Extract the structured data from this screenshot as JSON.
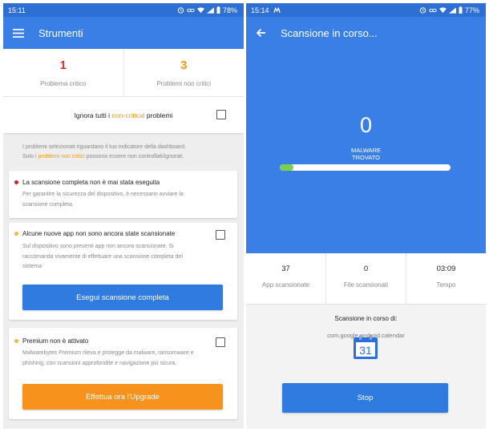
{
  "left": {
    "status": {
      "time": "15:11",
      "battery": "78%"
    },
    "appbar": {
      "title": "Strumenti"
    },
    "counts": [
      {
        "value": "1",
        "label": "Problema critico",
        "color": "#d32f2f"
      },
      {
        "value": "3",
        "label": "Problemi non critici",
        "color": "#ef9a1a"
      }
    ],
    "ignore": {
      "pre": "Ignora tutti i ",
      "highlight": "non-critical",
      "post": " problemi"
    },
    "info": {
      "line1": "I problemi selezionati riguardano il tuo indicatore della dashboard.",
      "line2_pre": "Solo i ",
      "line2_highlight": "problemi non critici",
      "line2_post": " possono essere non controllati/ignorati."
    },
    "cards": [
      {
        "title": "La scansione completa non è mai stata eseguita",
        "dot_color": "#c62828",
        "body": [
          "Per garantire la sicurezza del dispositivo, è necessario avviare la",
          "scansione completa."
        ]
      },
      {
        "title": "Alcune nuove app non sono ancora state scansionate",
        "dot_color": "#f6b24c",
        "body": [
          "Sul dispositivo sono presenti app non ancora scansionate. Si",
          "raccomanda vivamente di effettuare una scansione completa del",
          "sistema"
        ],
        "button": "Esegui scansione completa"
      },
      {
        "title": "Premium non è attivato",
        "dot_color": "#f6b24c",
        "body": [
          "Malwarebytes Premium rileva e protegge da malware, ransomware e",
          "phishing, con scansioni approfondite e navigazione più sicura."
        ],
        "button": "Effettua ora l'Upgrade"
      }
    ]
  },
  "right": {
    "status": {
      "time": "15:14",
      "battery": "77%"
    },
    "appbar": {
      "title": "Scansione in corso..."
    },
    "malware_count": "0",
    "malware_label_1": "MALWARE",
    "malware_label_2": "TROVATO",
    "progress": 0.08,
    "stats": [
      {
        "value": "37",
        "label": "App scansionate"
      },
      {
        "value": "0",
        "label": "File scansionati"
      },
      {
        "value": "03:09",
        "label": "Tempo"
      }
    ],
    "scanning_title": "Scansione in corso di:",
    "package": "com.google.android.calendar",
    "calendar_day": "31",
    "stop_label": "Stop"
  },
  "colors": {
    "accent_blue": "#3a7fe6",
    "button_blue": "#2f7be0",
    "upgrade_orange": "#f7921c",
    "progress_green": "#7ccf4c"
  }
}
